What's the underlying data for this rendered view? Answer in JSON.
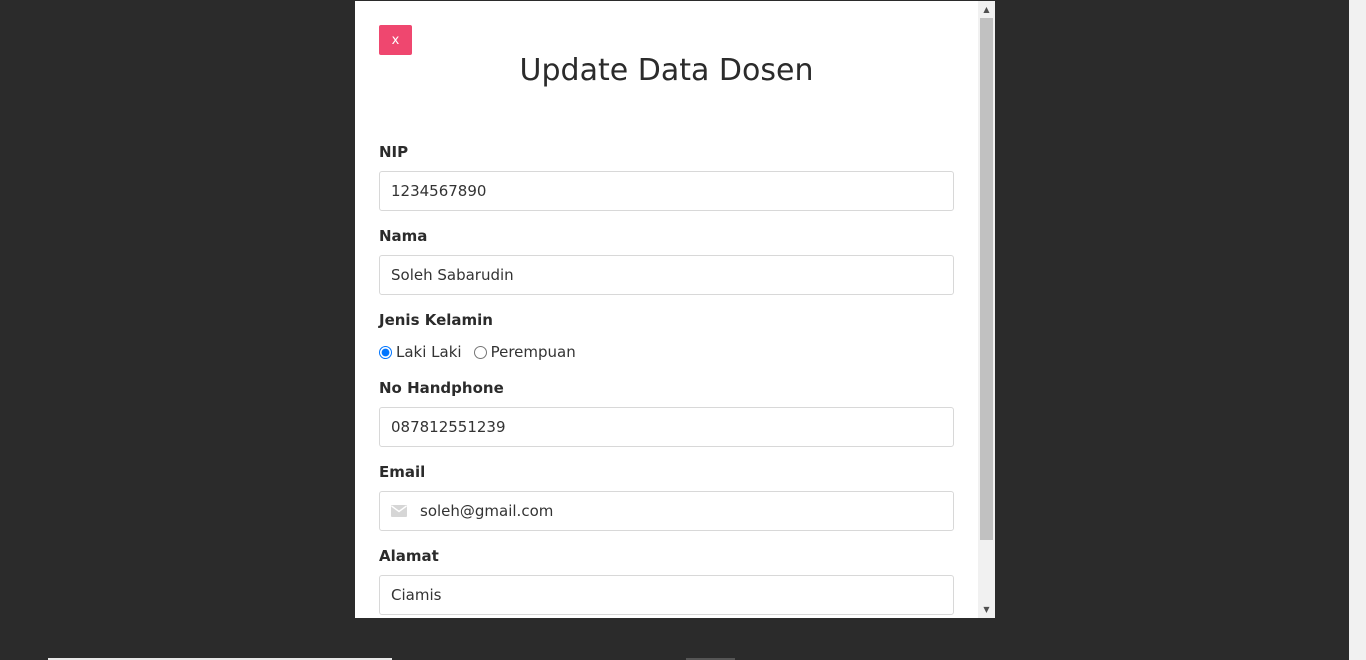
{
  "modal": {
    "close_label": "x",
    "title": "Update Data Dosen"
  },
  "form": {
    "nip": {
      "label": "NIP",
      "value": "1234567890"
    },
    "nama": {
      "label": "Nama",
      "value": "Soleh Sabarudin"
    },
    "jenis_kelamin": {
      "label": "Jenis Kelamin",
      "options": [
        {
          "label": "Laki Laki",
          "checked": true
        },
        {
          "label": "Perempuan",
          "checked": false
        }
      ]
    },
    "no_handphone": {
      "label": "No Handphone",
      "value": "087812551239"
    },
    "email": {
      "label": "Email",
      "value": "soleh@gmail.com",
      "icon": "envelope-icon"
    },
    "alamat": {
      "label": "Alamat",
      "value": "Ciamis"
    }
  },
  "colors": {
    "close_button": "#ef476f",
    "backdrop": "#2b2b2b",
    "radio_accent": "#0075ff"
  }
}
